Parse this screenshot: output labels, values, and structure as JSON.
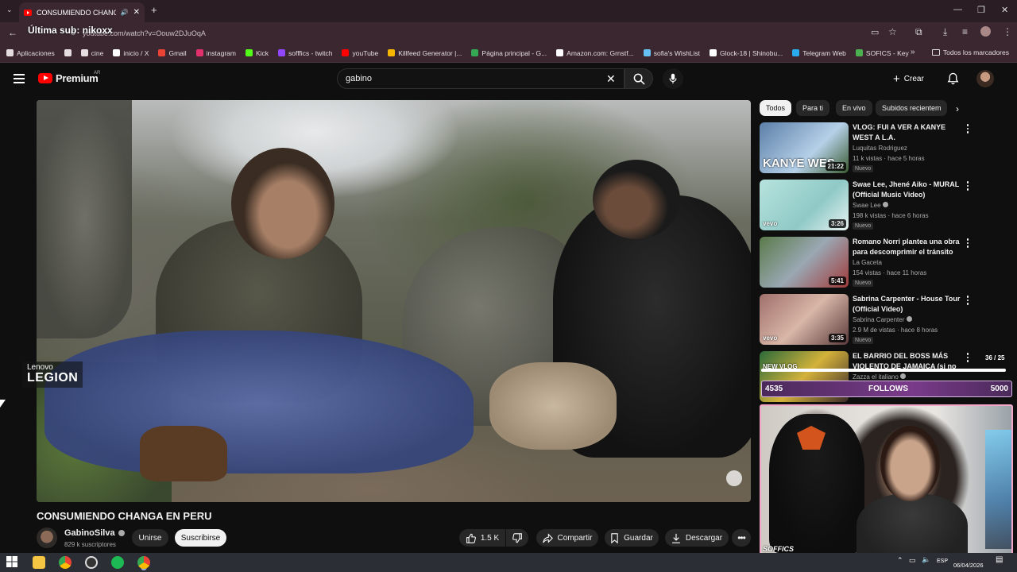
{
  "browser": {
    "tab_title": "CONSUMIENDO CHANGA |",
    "url": "youtube.com/watch?v=Oouw2DJuOqA",
    "overlay_text": "Última sub: nikoxx",
    "bookmarks": [
      {
        "label": "Aplicaciones",
        "icon": "apps-grid-icon",
        "color": "#e6dde1"
      },
      {
        "label": "",
        "icon": "grid-icon",
        "color": "#e6dde1"
      },
      {
        "label": "cine",
        "icon": "folder-icon",
        "color": "#e6dde1"
      },
      {
        "label": "inicio / X",
        "icon": "x-icon",
        "color": "#ffffff"
      },
      {
        "label": "Gmail",
        "icon": "gmail-icon",
        "color": "#ea4335"
      },
      {
        "label": "instagram",
        "icon": "instagram-icon",
        "color": "#e1306c"
      },
      {
        "label": "Kick",
        "icon": "kick-icon",
        "color": "#53fc18"
      },
      {
        "label": "sofffics - twitch",
        "icon": "twitch-icon",
        "color": "#9146ff"
      },
      {
        "label": "youTube",
        "icon": "youtube-icon",
        "color": "#ff0000"
      },
      {
        "label": "Killfeed Generator |...",
        "icon": "killfeed-icon",
        "color": "#f5b700"
      },
      {
        "label": "Página principal - G...",
        "icon": "drive-icon",
        "color": "#34a853"
      },
      {
        "label": "Amazon.com: Grnstf...",
        "icon": "amazon-icon",
        "color": "#ffffff"
      },
      {
        "label": "sofia's WishList",
        "icon": "steam-icon",
        "color": "#66c0f4"
      },
      {
        "label": "Glock-18 | Shinobu...",
        "icon": "f-icon",
        "color": "#ffffff"
      },
      {
        "label": "Telegram Web",
        "icon": "telegram-icon",
        "color": "#2aabee"
      },
      {
        "label": "SOFICS - Key",
        "icon": "key-icon",
        "color": "#4caf50"
      }
    ],
    "bookmarks_more": "»",
    "all_bookmarks": "Todos los marcadores"
  },
  "youtube": {
    "logo": "Premium",
    "logo_country": "AR",
    "search_value": "gabino",
    "create_label": "Crear"
  },
  "video": {
    "title": "CONSUMIENDO CHANGA EN PERU",
    "watermark_top": "Lenovo",
    "watermark_bottom": "LEGION",
    "channel": "GabinoSilva",
    "subscribers": "829 k suscriptores",
    "join_label": "Unirse",
    "subscribe_label": "Suscribirse",
    "likes": "1.5 K",
    "share_label": "Compartir",
    "save_label": "Guardar",
    "download_label": "Descargar"
  },
  "chips": [
    "Todos",
    "Para ti",
    "En vivo",
    "Subidos recientem"
  ],
  "recommendations": [
    {
      "title": "VLOG: FUI A VER A KANYE WEST A L.A.",
      "channel": "Luquitas Rodriguez",
      "meta": "11 k vistas · hace 5 horas",
      "badge": "Nuevo",
      "duration": "21:22",
      "verified": false,
      "thumb_text": "KANYE WES"
    },
    {
      "title": "Swae Lee, Jhené Aiko - MURAL (Official Music Video)",
      "channel": "Swae Lee",
      "meta": "198 k vistas · hace 6 horas",
      "badge": "Nuevo",
      "duration": "3:26",
      "verified": true,
      "thumb_text": "vevo"
    },
    {
      "title": "Romano Norri plantea una obra para descomprimir el tránsito ...",
      "channel": "La Gaceta",
      "meta": "154 vistas · hace 11 horas",
      "badge": "Nuevo",
      "duration": "5:41",
      "verified": false,
      "thumb_text": ""
    },
    {
      "title": "Sabrina Carpenter - House Tour (Official Video)",
      "channel": "Sabrina Carpenter",
      "meta": "2.9 M de vistas · hace 8 horas",
      "badge": "Nuevo",
      "duration": "3:35",
      "verified": true,
      "thumb_text": "vevo"
    },
    {
      "title": "EL BARRIO DEL BOSS MÁS VIOLENTO DE JAMAICA (si no",
      "channel": "Zazza el italiano",
      "meta": "",
      "badge": "Nuevo",
      "duration": "",
      "verified": true,
      "thumb_text": "NEW VLOG"
    }
  ],
  "stream_overlay": {
    "goal_count": "36 / 25",
    "left_value": "4535",
    "center_label": "FOLLOWS",
    "right_value": "5000",
    "webcam_label": "SOFFICS"
  },
  "taskbar": {
    "lang": "ESP",
    "date": "06/04/2026"
  }
}
